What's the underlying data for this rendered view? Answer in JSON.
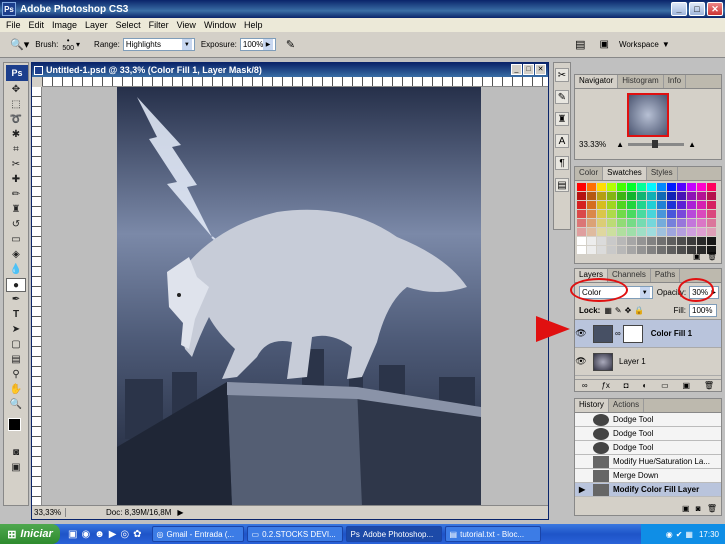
{
  "app": {
    "title": "Adobe Photoshop CS3",
    "logo": "Ps"
  },
  "menu": [
    "File",
    "Edit",
    "Image",
    "Layer",
    "Select",
    "Filter",
    "View",
    "Window",
    "Help"
  ],
  "options": {
    "brush_label": "Brush:",
    "brush_size": "500",
    "range_label": "Range:",
    "range_value": "Highlights",
    "exposure_label": "Exposure:",
    "exposure_value": "100%",
    "workspace_label": "Workspace"
  },
  "document": {
    "title": "Untitled-1.psd @ 33,3% (Color Fill 1, Layer Mask/8)",
    "zoom": "33,33%",
    "info": "Doc: 8,39M/16,8M"
  },
  "navigator": {
    "tabs": [
      "Navigator",
      "Histogram",
      "Info"
    ],
    "zoom": "33.33%"
  },
  "swatches": {
    "tabs": [
      "Color",
      "Swatches",
      "Styles"
    ]
  },
  "layers": {
    "tabs": [
      "Layers",
      "Channels",
      "Paths"
    ],
    "blend_mode": "Color",
    "opacity_label": "Opacity:",
    "opacity_value": "30%",
    "lock_label": "Lock:",
    "fill_label": "Fill:",
    "fill_value": "100%",
    "items": [
      {
        "name": "Color Fill 1"
      },
      {
        "name": "Layer 1"
      }
    ]
  },
  "history": {
    "tabs": [
      "History",
      "Actions"
    ],
    "items": [
      "Dodge Tool",
      "Dodge Tool",
      "Dodge Tool",
      "Modify Hue/Saturation La...",
      "Merge Down",
      "Modify Color Fill Layer"
    ]
  },
  "taskbar": {
    "start": "Iniciar",
    "items": [
      "Gmail - Entrada (...",
      "0.2.STOCKS DEVI...",
      "Adobe Photoshop...",
      "tutorial.txt - Bloc..."
    ],
    "clock": "17:30"
  },
  "colors": {
    "annotation_red": "#e01010",
    "title_blue": "#0a246a"
  }
}
